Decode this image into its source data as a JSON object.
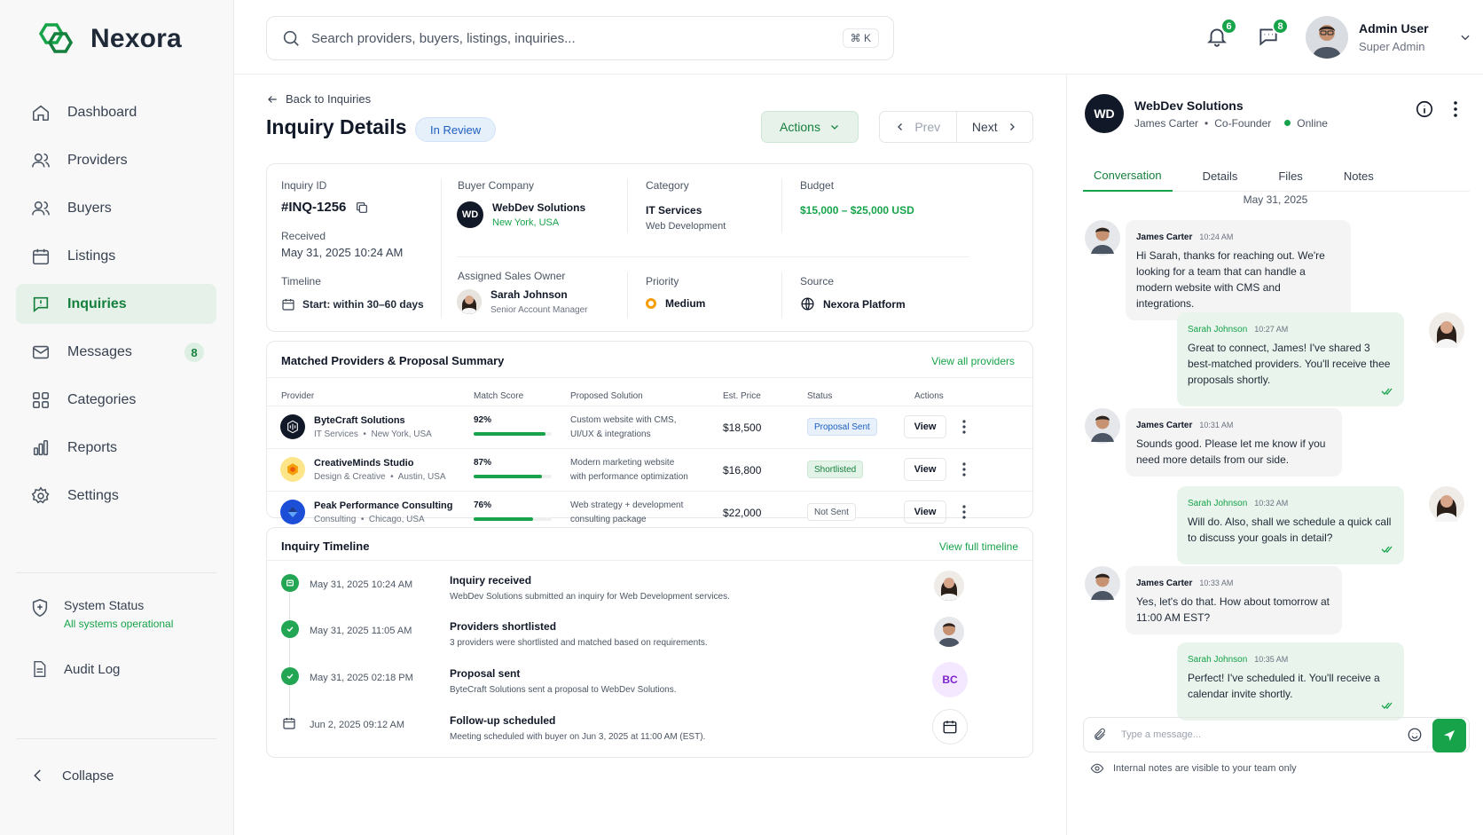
{
  "brand": {
    "name": "Nexora"
  },
  "sidebar": {
    "items": [
      {
        "label": "Dashboard",
        "icon": "home-icon"
      },
      {
        "label": "Providers",
        "icon": "users-icon"
      },
      {
        "label": "Buyers",
        "icon": "users-icon"
      },
      {
        "label": "Listings",
        "icon": "calendar-icon"
      },
      {
        "label": "Inquiries",
        "icon": "inquiry-icon",
        "active": true
      },
      {
        "label": "Messages",
        "icon": "mail-icon",
        "badge": "8"
      },
      {
        "label": "Categories",
        "icon": "grid-icon"
      },
      {
        "label": "Reports",
        "icon": "bar-chart-icon"
      },
      {
        "label": "Settings",
        "icon": "gear-icon"
      }
    ],
    "system_status": {
      "title": "System Status",
      "subtitle": "All systems operational"
    },
    "audit_log": "Audit Log",
    "collapse": "Collapse"
  },
  "topbar": {
    "search_placeholder": "Search providers, buyers, listings, inquiries...",
    "shortcut": "⌘ K",
    "notifications_count": "6",
    "messages_count": "8",
    "user": {
      "name": "Admin User",
      "role": "Super Admin"
    }
  },
  "inquiry": {
    "back_label": "Back to Inquiries",
    "title": "Inquiry Details",
    "status": "In Review",
    "actions_label": "Actions",
    "prev_label": "Prev",
    "next_label": "Next",
    "id_label": "Inquiry ID",
    "id": "#INQ-1256",
    "received_label": "Received",
    "received": "May 31, 2025 10:24 AM",
    "timeline_label": "Timeline",
    "timeline": "Start: within 30–60 days",
    "buyer_label": "Buyer Company",
    "buyer_name": "WebDev Solutions",
    "buyer_location": "New York, USA",
    "buyer_logo": "WD",
    "category_label": "Category",
    "category": "IT Services",
    "subcategory": "Web Development",
    "budget_label": "Budget",
    "budget": "$15,000 – $25,000 USD",
    "owner_label": "Assigned Sales Owner",
    "owner_name": "Sarah Johnson",
    "owner_role": "Senior Account Manager",
    "priority_label": "Priority",
    "priority": "Medium",
    "source_label": "Source",
    "source": "Nexora Platform"
  },
  "providers": {
    "title": "Matched Providers & Proposal Summary",
    "view_all": "View all providers",
    "columns": [
      "Provider",
      "Match Score",
      "Proposed Solution",
      "Est. Price",
      "Status",
      "Actions"
    ],
    "rows": [
      {
        "name": "ByteCraft Solutions",
        "category": "IT Services",
        "location": "New York, USA",
        "score": "92%",
        "score_value": 0.92,
        "solution_1": "Custom website with CMS,",
        "solution_2": "UI/UX & integrations",
        "price": "$18,500",
        "status": "Proposal Sent",
        "status_kind": "sent",
        "action": "View",
        "logo_color": "#111827"
      },
      {
        "name": "CreativeMinds Studio",
        "category": "Design & Creative",
        "location": "Austin, USA",
        "score": "87%",
        "score_value": 0.87,
        "solution_1": "Modern marketing website",
        "solution_2": "with performance optimization",
        "price": "$16,800",
        "status": "Shortlisted",
        "status_kind": "short",
        "action": "View",
        "logo_color": "#f59e0b"
      },
      {
        "name": "Peak Performance Consulting",
        "category": "Consulting",
        "location": "Chicago, USA",
        "score": "76%",
        "score_value": 0.76,
        "solution_1": "Web strategy + development",
        "solution_2": "consulting package",
        "price": "$22,000",
        "status": "Not Sent",
        "status_kind": "not",
        "action": "View",
        "logo_color": "#1d4ed8"
      }
    ]
  },
  "timeline": {
    "title": "Inquiry Timeline",
    "view_full": "View full timeline",
    "items": [
      {
        "date": "May 31, 2025 10:24 AM",
        "title": "Inquiry received",
        "desc": "WebDev Solutions submitted an inquiry for Web Development services."
      },
      {
        "date": "May 31, 2025 11:05 AM",
        "title": "Providers shortlisted",
        "desc": "3 providers were shortlisted and matched based on requirements."
      },
      {
        "date": "May 31, 2025 02:18 PM",
        "title": "Proposal sent",
        "desc": "ByteCraft Solutions sent a proposal to WebDev Solutions.",
        "avatar_text": "BC"
      },
      {
        "date": "Jun 2, 2025 09:12 AM",
        "title": "Follow-up scheduled",
        "desc": "Meeting scheduled with buyer on Jun 3, 2025 at 11:00 AM (EST)."
      }
    ]
  },
  "chat": {
    "company": "WebDev Solutions",
    "logo": "WD",
    "contact": "James Carter",
    "contact_role": "Co-Founder",
    "presence": "Online",
    "tabs": [
      "Conversation",
      "Details",
      "Files",
      "Notes"
    ],
    "date_divider": "May 31, 2025",
    "messages": [
      {
        "from": "James Carter",
        "time": "10:24 AM",
        "text": "Hi Sarah, thanks for reaching out. We're looking for a team that can handle a modern website with CMS and integrations."
      },
      {
        "from": "Sarah Johnson",
        "time": "10:27 AM",
        "text": "Great to connect, James! I've shared 3 best-matched providers. You'll receive thee proposals shortly."
      },
      {
        "from": "James Carter",
        "time": "10:31 AM",
        "text": "Sounds good. Please let me know if you need more details from our side."
      },
      {
        "from": "Sarah Johnson",
        "time": "10:32 AM",
        "text": "Will do. Also, shall we schedule a quick call to discuss your goals in detail?"
      },
      {
        "from": "James Carter",
        "time": "10:33 AM",
        "text": "Yes, let's do that. How about tomorrow at 11:00 AM EST?"
      },
      {
        "from": "Sarah Johnson",
        "time": "10:35 AM",
        "text": "Perfect! I've scheduled it. You'll receive a calendar invite shortly."
      }
    ],
    "composer_placeholder": "Type a message...",
    "footer_note": "Internal notes are visible to your team only"
  },
  "colors": {
    "accent": "#16a34a",
    "accent_bg": "#e6f1ea",
    "status_blue": "#1d5fbf",
    "priority": "#f59e0b"
  }
}
